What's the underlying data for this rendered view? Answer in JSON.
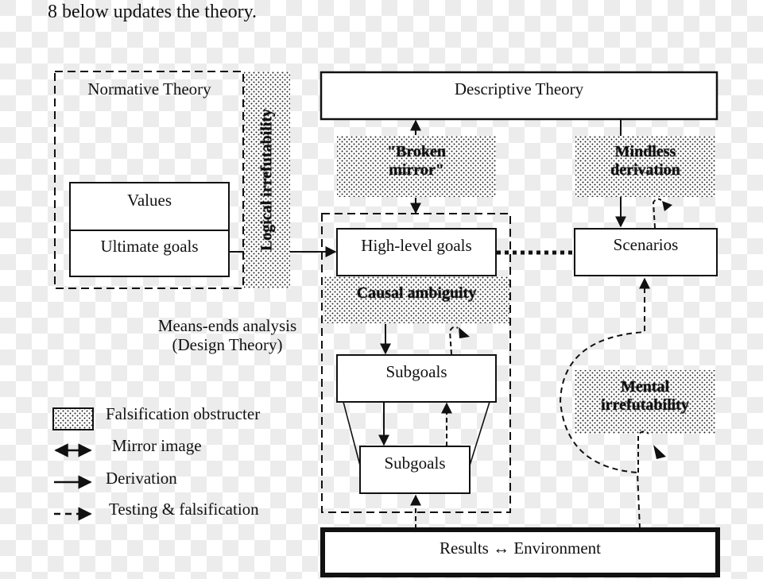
{
  "intro_text": "8 below updates the theory.",
  "diagram": {
    "normative_theory": {
      "title": "Normative Theory",
      "values": "Values",
      "ultimate_goals": "Ultimate goals"
    },
    "logical_irrefutability": "Logical irrefutability",
    "descriptive_theory": "Descriptive Theory",
    "broken_mirror": [
      "\"Broken",
      "mirror\""
    ],
    "mindless_derivation": [
      "Mindless",
      "derivation"
    ],
    "high_level_goals": "High-level goals",
    "scenarios": "Scenarios",
    "causal_ambiguity": "Causal ambiguity",
    "means_ends": [
      "Means-ends analysis",
      "(Design Theory)"
    ],
    "subgoals_upper": "Subgoals",
    "subgoals_lower": "Subgoals",
    "mental_irrefutability": [
      "Mental",
      "irrefutability"
    ],
    "results_environment": "Results ↔ Environment"
  },
  "legend": {
    "items": [
      {
        "icon": "dotted-box",
        "label": "Falsification obstructer"
      },
      {
        "icon": "double-arrow",
        "label": "Mirror image"
      },
      {
        "icon": "solid-arrow",
        "label": "Derivation"
      },
      {
        "icon": "dashed-arrow",
        "label": "Testing & falsification"
      }
    ]
  },
  "colors": {
    "ink": "#111111",
    "box_fill": "#ffffff"
  }
}
